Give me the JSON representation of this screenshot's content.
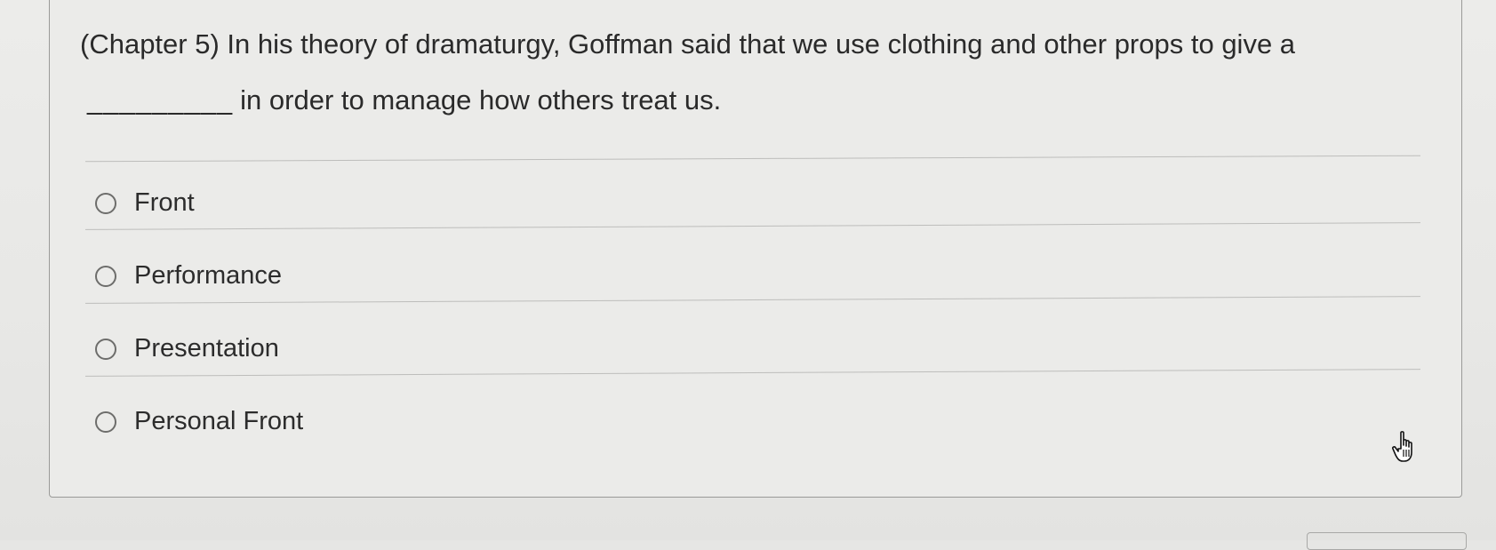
{
  "question": {
    "prefix": "(Chapter 5) In his theory of dramaturgy, Goffman said that we use clothing and other props to give a",
    "blank": "_________",
    "suffix": "in order to manage how others treat us."
  },
  "options": [
    {
      "label": "Front",
      "selected": false
    },
    {
      "label": "Performance",
      "selected": false
    },
    {
      "label": "Presentation",
      "selected": false
    },
    {
      "label": "Personal Front",
      "selected": false
    }
  ],
  "icons": {
    "cursor": "hand-pointer-icon",
    "radio": "radio-button-icon"
  }
}
